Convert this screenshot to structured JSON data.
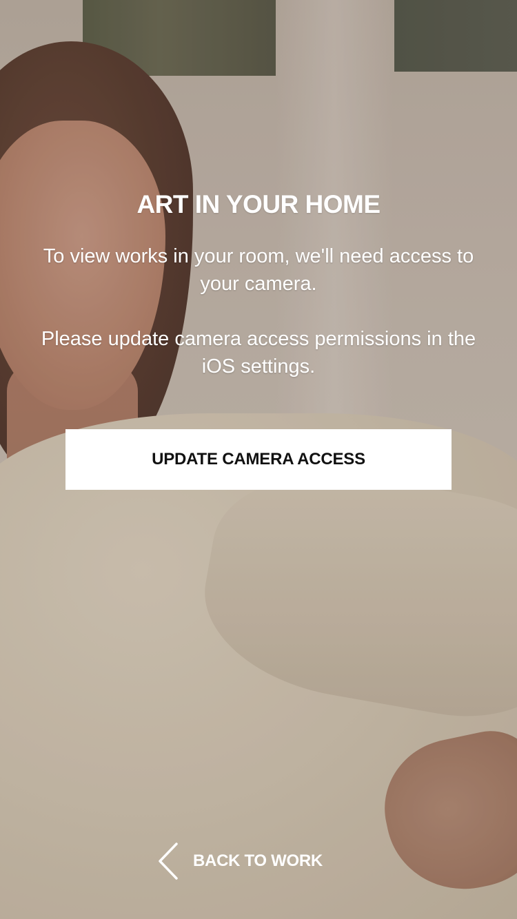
{
  "screen": {
    "title": "ART IN YOUR HOME",
    "message_line1": "To view works in your room, we'll need access to your camera.",
    "message_line2": "Please update camera access permissions in the iOS settings."
  },
  "actions": {
    "primary_label": "UPDATE CAMERA ACCESS",
    "back_label": "BACK TO WORK",
    "back_icon": "chevron-left-icon"
  },
  "colors": {
    "text": "#ffffff",
    "button_bg": "#ffffff",
    "button_text": "#111111"
  }
}
